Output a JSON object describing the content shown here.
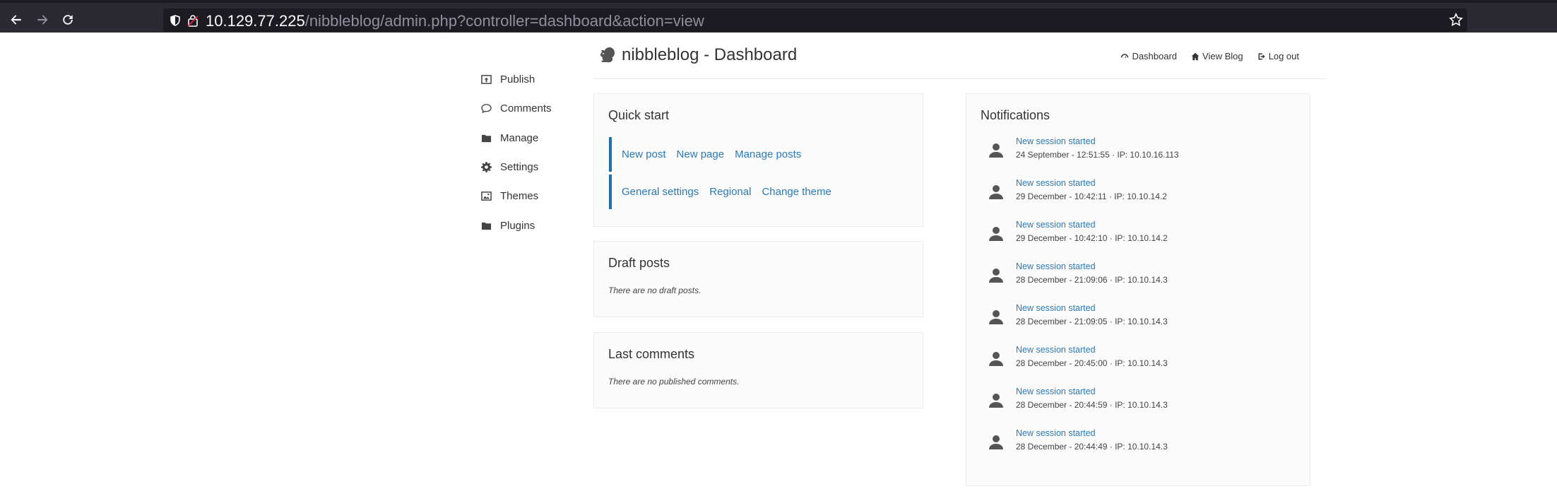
{
  "browser": {
    "url_host": "10.129.77.225",
    "url_path": "/nibbleblog/admin.php?controller=dashboard&action=view"
  },
  "sidebar": {
    "items": [
      {
        "label": "Publish",
        "icon": "publish-icon"
      },
      {
        "label": "Comments",
        "icon": "comment-icon"
      },
      {
        "label": "Manage",
        "icon": "folder-icon"
      },
      {
        "label": "Settings",
        "icon": "gear-icon"
      },
      {
        "label": "Themes",
        "icon": "image-icon"
      },
      {
        "label": "Plugins",
        "icon": "folder-icon"
      }
    ]
  },
  "header": {
    "title": "nibbleblog - Dashboard",
    "links": {
      "dashboard": "Dashboard",
      "view_blog": "View Blog",
      "logout": "Log out"
    }
  },
  "quick_start": {
    "title": "Quick start",
    "row1": [
      "New post",
      "New page",
      "Manage posts"
    ],
    "row2": [
      "General settings",
      "Regional",
      "Change theme"
    ]
  },
  "draft_posts": {
    "title": "Draft posts",
    "empty": "There are no draft posts."
  },
  "last_comments": {
    "title": "Last comments",
    "empty": "There are no published comments."
  },
  "notifications": {
    "title": "Notifications",
    "items": [
      {
        "title": "New session started",
        "meta": "24 September - 12:51:55 · IP: 10.10.16.113"
      },
      {
        "title": "New session started",
        "meta": "29 December - 10:42:11 · IP: 10.10.14.2"
      },
      {
        "title": "New session started",
        "meta": "29 December - 10:42:10 · IP: 10.10.14.2"
      },
      {
        "title": "New session started",
        "meta": "28 December - 21:09:06 · IP: 10.10.14.3"
      },
      {
        "title": "New session started",
        "meta": "28 December - 21:09:05 · IP: 10.10.14.3"
      },
      {
        "title": "New session started",
        "meta": "28 December - 20:45:00 · IP: 10.10.14.3"
      },
      {
        "title": "New session started",
        "meta": "28 December - 20:44:59 · IP: 10.10.14.3"
      },
      {
        "title": "New session started",
        "meta": "28 December - 20:44:49 · IP: 10.10.14.3"
      }
    ]
  },
  "colors": {
    "link": "#2a7ab8",
    "accent_bar": "#1e6eb4",
    "browser_bg": "#2b2a33"
  }
}
